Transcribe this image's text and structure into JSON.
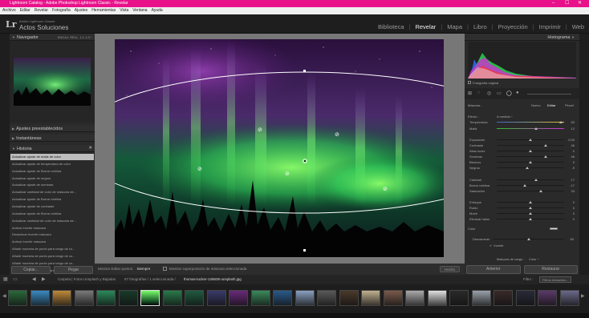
{
  "window": {
    "title": "Lightroom Catalog - Adobe Photoshop Lightroom Classic - Revelar",
    "controls": [
      "–",
      "☐",
      "✕"
    ]
  },
  "menu": [
    "Archivo",
    "Editar",
    "Revelar",
    "Fotografía",
    "Ajustes",
    "Herramientas",
    "Vista",
    "Ventana",
    "Ayuda"
  ],
  "identity": {
    "logo": "Lr",
    "line1": "Adobe Lightroom Classic",
    "line2": "Actos Soluciones"
  },
  "modules": [
    "Biblioteca",
    "Revelar",
    "Mapa",
    "Libro",
    "Proyección",
    "Imprimir",
    "Web"
  ],
  "active_module": "Revelar",
  "left": {
    "navigator_title": "Navegador",
    "navigator_zoom": "ENCAJ.   RELL.   1:1   1:3 ÷",
    "presets_title": "Ajustes preestablecidos",
    "snapshots_title": "Instantáneas",
    "history_title": "Historia",
    "history": [
      "Actualizar ajuste de matiz de color",
      "Actualizar ajuste de temperatura de color",
      "Actualizar ajuste de Borrar neblina",
      "Actualizar ajuste de negros",
      "Actualizar ajuste de sombras",
      "Actualizar cantidad de color de máscara de...",
      "Actualizar ajuste de Borrar neblina",
      "Actualizar ajuste de contraste",
      "Actualizar ajuste de Borrar neblina",
      "Actualizar cantidad de color de máscara de...",
      "Activar Invertir máscara",
      "Desactivar Invertir máscara",
      "Activar Invertir máscara",
      "Añadir muestra de punto para rango de co...",
      "Añadir muestra de punto para rango de co...",
      "Añadir muestra de punto para rango de co...",
      "Añadir muestra de punto para rango de co...",
      "Añadir muestra de punto para rango de co...",
      "Tipo de máscara de rango: color"
    ],
    "copy": "Copiar...",
    "paste": "Pegar"
  },
  "toolbar": {
    "overlay_label": "Mostrar Editar puntos:",
    "overlay_value": "Siempre",
    "mask_overlay": "Mostrar superposición de máscara seleccionada",
    "done": "Hecho"
  },
  "right": {
    "histogram_title": "Histograma",
    "original_photo": "Fotografía original",
    "mask_label": "Máscara :",
    "mask_tabs": [
      "Nuevo",
      "Editar",
      "Pincel"
    ],
    "effect_label": "Efecto :",
    "effect_value": "A medida ÷",
    "sliders": [
      {
        "label": "Temperatura",
        "value": "83",
        "pos": 0.95
      },
      {
        "label": "Matiz",
        "value": "12",
        "pos": 0.58
      },
      {
        "label": "Exposición",
        "value": "0,00",
        "pos": 0.5
      },
      {
        "label": "Contraste",
        "value": "46",
        "pos": 0.73
      },
      {
        "label": "Altas luces",
        "value": "0",
        "pos": 0.5
      },
      {
        "label": "Sombras",
        "value": "46",
        "pos": 0.73
      },
      {
        "label": "Blancos",
        "value": "0",
        "pos": 0.5
      },
      {
        "label": "Negros",
        "value": "-9",
        "pos": 0.45
      },
      {
        "label": "Claridad",
        "value": "17",
        "pos": 0.58
      },
      {
        "label": "Borrar neblina",
        "value": "-17",
        "pos": 0.42
      },
      {
        "label": "Saturación",
        "value": "33",
        "pos": 0.66
      },
      {
        "label": "Enfoque",
        "value": "0",
        "pos": 0.5
      },
      {
        "label": "Ruido",
        "value": "0",
        "pos": 0.5
      },
      {
        "label": "Moiré",
        "value": "0",
        "pos": 0.5
      },
      {
        "label": "Eliminar halos",
        "value": "0",
        "pos": 0.5
      }
    ],
    "color_label": "Color",
    "amount_label": "Desvanecer",
    "amount_value": "50",
    "invert_label": "Invertir",
    "range_mask_label": "Máscara de rango :",
    "range_mask_value": "Color ÷",
    "previous": "Anterior",
    "reset": "Restaurar"
  },
  "filmbar": {
    "source": "Carpeta | Fotos Unsplash y Bajadas",
    "count": "67 fotografías / 1 seleccionada /",
    "filename": "thomas-tucker-126635-unsplash.jpg",
    "filter_label": "Filtro :",
    "filter_value": "Filtros desactiva..."
  },
  "colors": {
    "titlebar": "#e8118a",
    "panel": "#2a2a2a",
    "background": "#777777"
  }
}
